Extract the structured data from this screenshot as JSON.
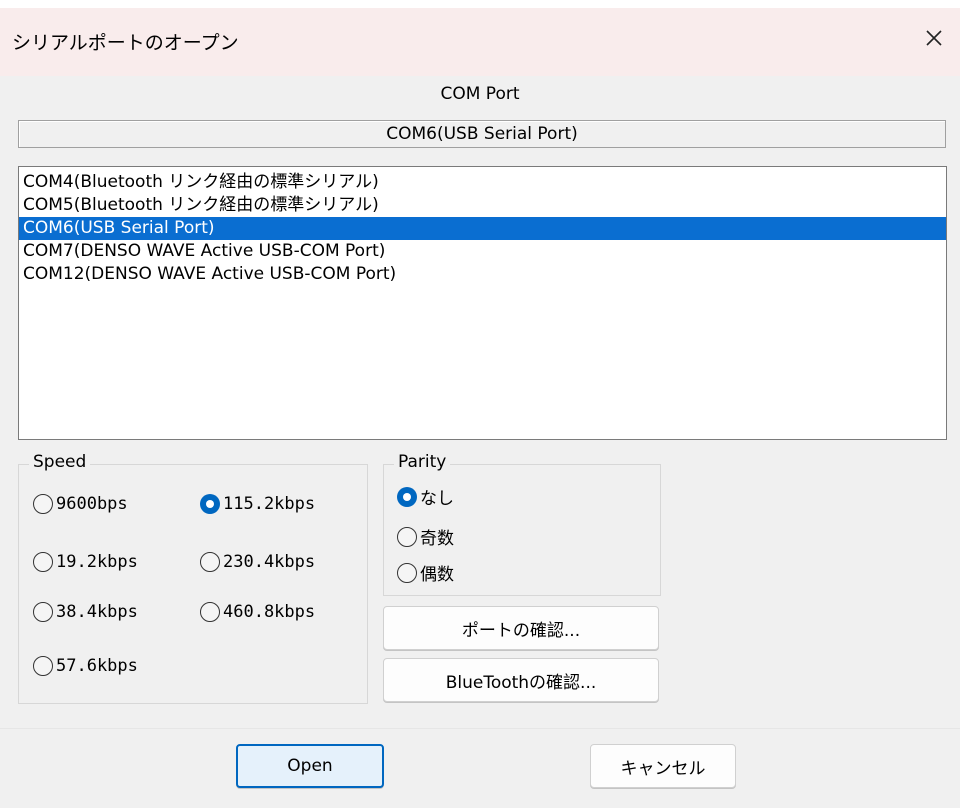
{
  "window": {
    "title": "シリアルポートのオープン",
    "close_icon": "close-icon"
  },
  "port": {
    "caption": "COM Port",
    "selected_display": "COM6(USB Serial Port)",
    "items": [
      "COM4(Bluetooth リンク経由の標準シリアル)",
      "COM5(Bluetooth リンク経由の標準シリアル)",
      "COM6(USB Serial Port)",
      "COM7(DENSO WAVE Active USB-COM Port)",
      "COM12(DENSO WAVE Active USB-COM Port)"
    ],
    "selected_index": 2
  },
  "speed": {
    "legend": "Speed",
    "options": [
      "9600bps",
      "115.2kbps",
      "19.2kbps",
      "230.4kbps",
      "38.4kbps",
      "460.8kbps",
      "57.6kbps"
    ],
    "selected": "115.2kbps"
  },
  "parity": {
    "legend": "Parity",
    "options": [
      "なし",
      "奇数",
      "偶数"
    ],
    "selected": "なし"
  },
  "buttons": {
    "check_port": "ポートの確認...",
    "check_bluetooth": "BlueToothの確認...",
    "open": "Open",
    "cancel": "キャンセル"
  },
  "colors": {
    "selection": "#0a6ed1",
    "radio_checked": "#0067c0",
    "titlebar": "#f9ecec",
    "dialog_bg": "#f0f0f0"
  }
}
